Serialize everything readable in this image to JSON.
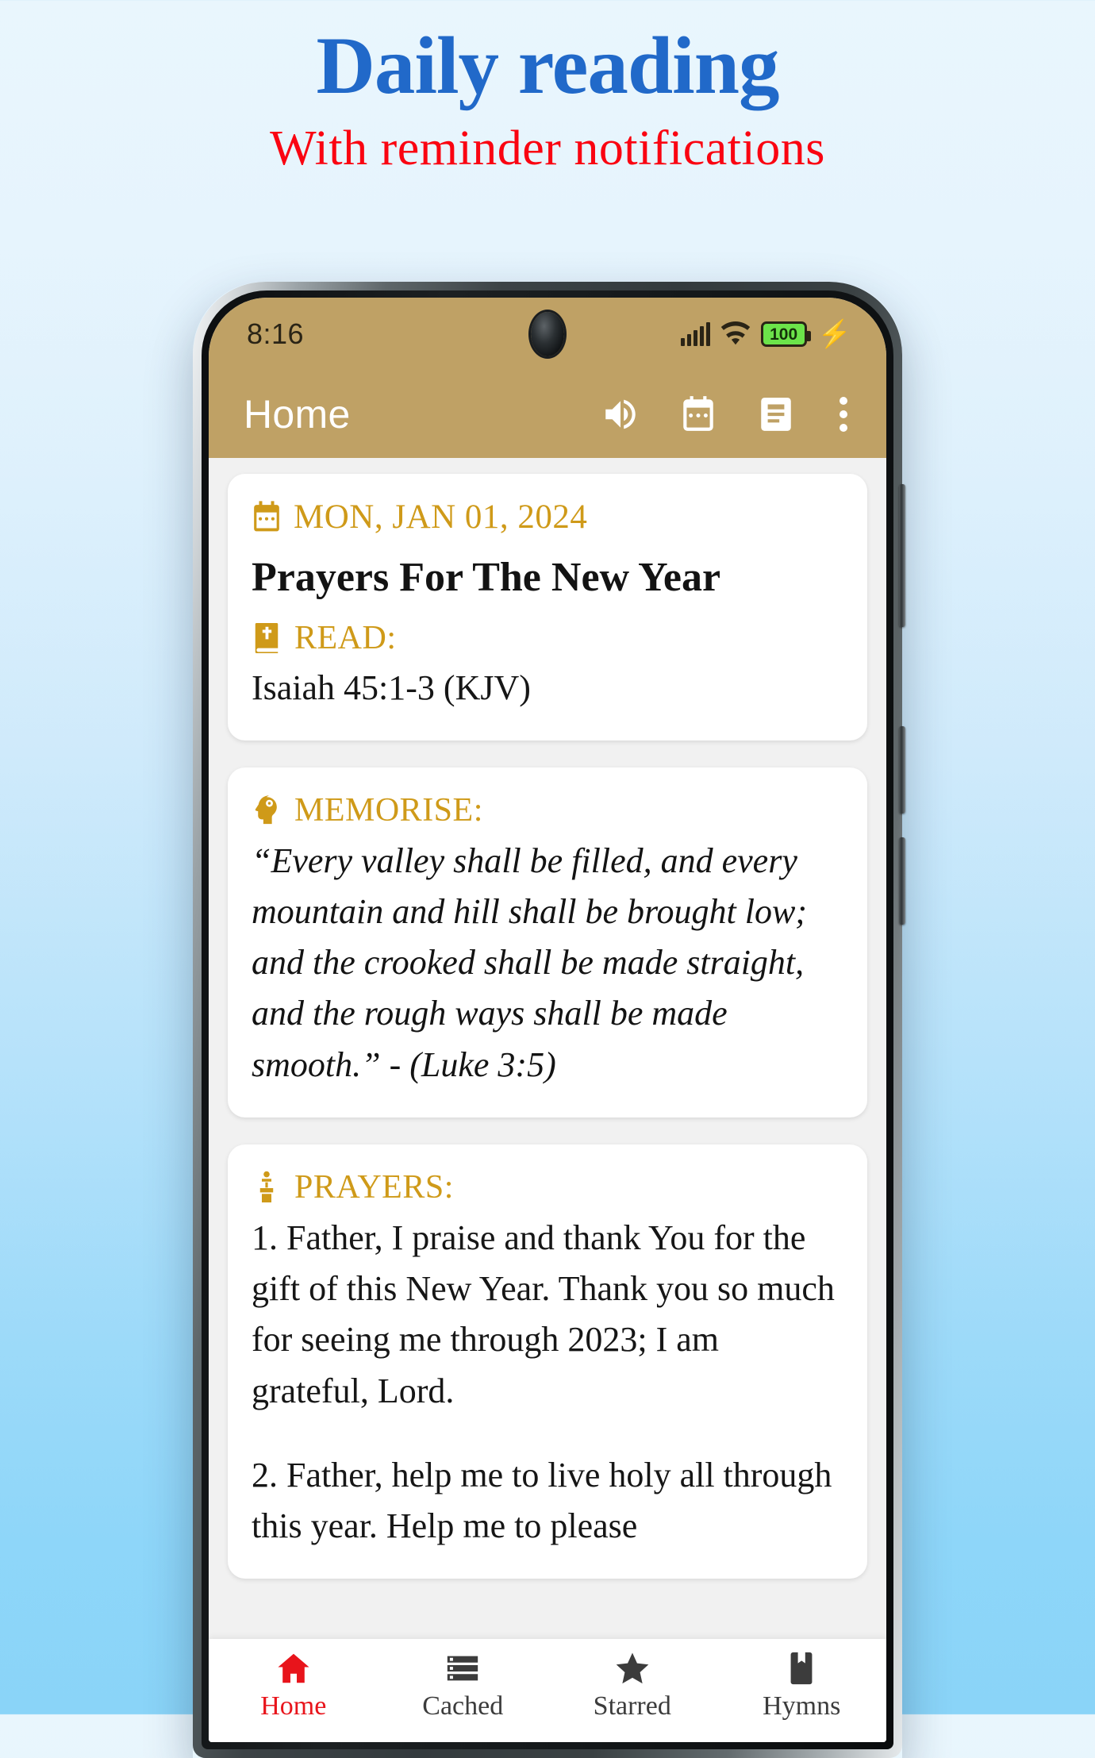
{
  "promo": {
    "title": "Daily reading",
    "subtitle": "With reminder notifications",
    "title_color": "#2169c9",
    "subtitle_color": "#fa0411"
  },
  "phone": {
    "status_bar": {
      "time": "8:16",
      "battery_level": "100",
      "charging_icon": "lightning-bolt-icon",
      "wifi_icon": "wifi-icon",
      "signal_icon": "signal-bars-icon"
    },
    "app_bar": {
      "title": "Home",
      "background_color": "#bfa165",
      "actions": [
        {
          "name": "volume-icon",
          "label": "Volume"
        },
        {
          "name": "calendar-icon",
          "label": "Calendar"
        },
        {
          "name": "article-icon",
          "label": "Article"
        },
        {
          "name": "overflow-menu-icon",
          "label": "More options"
        }
      ]
    },
    "devotional": {
      "accent_color": "#cf9a19",
      "date": "MON, JAN 01, 2024",
      "date_icon": "calendar-icon",
      "title": "Prayers For The New Year",
      "read": {
        "icon": "bible-icon",
        "label": "READ:",
        "text": "Isaiah 45:1-3 (KJV)"
      },
      "memorise": {
        "icon": "brain-head-icon",
        "label": "MEMORISE:",
        "text": "“Every valley shall be filled, and every mountain and hill shall be brought low; and the crooked shall be made straight, and the rough ways shall be made smooth.” - (Luke 3:5)"
      },
      "prayers": {
        "icon": "podium-icon",
        "label": "PRAYERS:",
        "items": [
          "1. Father, I praise and thank You for the gift of this New Year. Thank you so much for seeing me through 2023; I am grateful, Lord.",
          "2. Father, help me to live holy all through this year. Help me to please"
        ]
      }
    },
    "bottom_nav": {
      "active_color": "#e8141b",
      "items": [
        {
          "label": "Home",
          "icon": "home-icon",
          "active": true
        },
        {
          "label": "Cached",
          "icon": "list-storage-icon",
          "active": false
        },
        {
          "label": "Starred",
          "icon": "star-icon",
          "active": false
        },
        {
          "label": "Hymns",
          "icon": "bookmark-book-icon",
          "active": false
        }
      ]
    }
  }
}
